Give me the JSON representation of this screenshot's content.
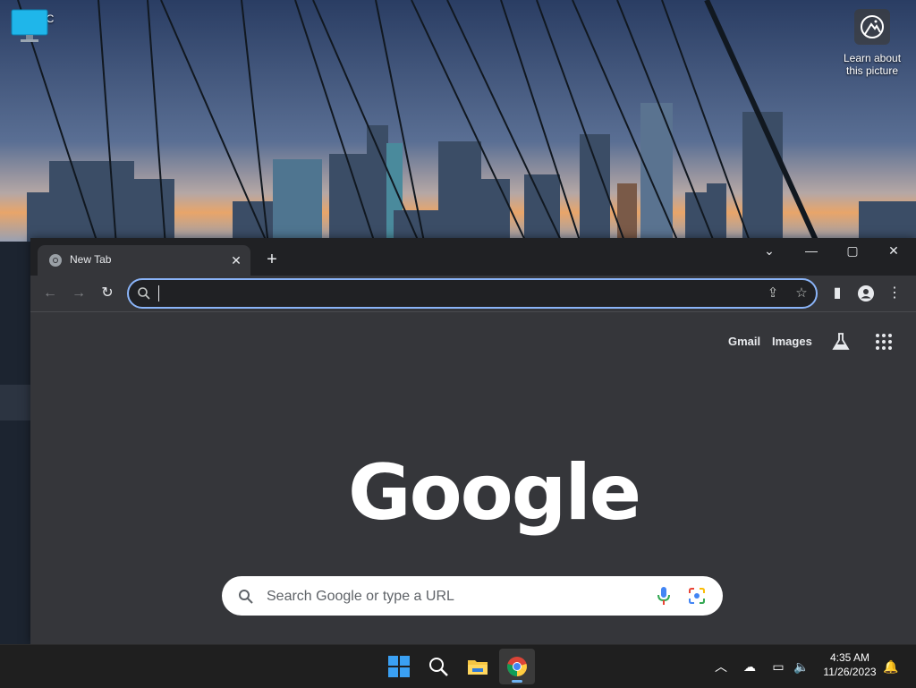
{
  "desktop": {
    "icons": [
      {
        "label": "This PC"
      },
      {
        "label_line1": "Learn about",
        "label_line2": "this picture"
      }
    ]
  },
  "browser": {
    "tab": {
      "title": "New Tab"
    },
    "omnibox": {
      "value": ""
    },
    "page": {
      "gmail": "Gmail",
      "images": "Images",
      "logo": "Google",
      "search_placeholder": "Search Google or type a URL"
    }
  },
  "taskbar": {
    "clock_time": "4:35 AM",
    "clock_date": "11/26/2023",
    "apps": [
      "start-icon",
      "search-icon",
      "file-explorer-icon",
      "chrome-icon"
    ]
  },
  "colors": {
    "accent": "#8ab4f8",
    "browser_bg": "#35363a",
    "titlebar_bg": "#202124",
    "taskbar_bg": "#1f1f1f"
  }
}
